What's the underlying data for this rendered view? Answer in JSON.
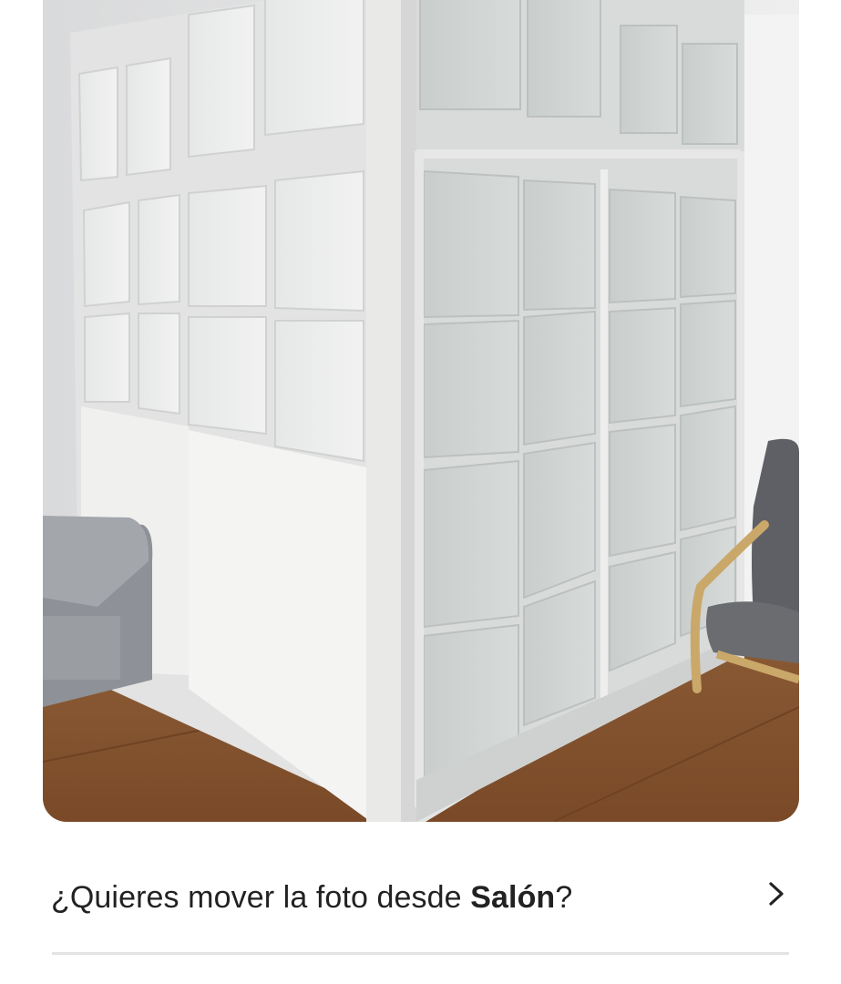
{
  "photo": {
    "alt": "Sala con cerramiento de puertas correderas de aluminio blanco y cristal",
    "open_action": "open-photo"
  },
  "prompt": {
    "text_before": "¿Quieres mover la foto desde ",
    "room_name": "Salón",
    "text_after": "?"
  },
  "icons": {
    "chevron": "chevron-right-icon"
  },
  "colors": {
    "text": "#222222",
    "divider": "#e3e3e3",
    "background": "#ffffff"
  }
}
